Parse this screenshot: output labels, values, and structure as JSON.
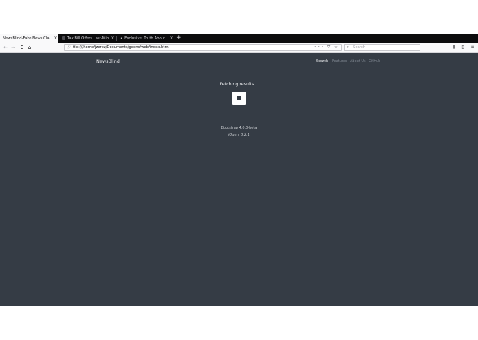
{
  "tabs": [
    {
      "title": "NewsBlind-Fake News Cla",
      "close": "×",
      "active": true
    },
    {
      "title": "Tax Bill Offers Last-Min",
      "close": "×",
      "active": false
    },
    {
      "title": "Exclusive: Truth About",
      "close": "×",
      "active": false
    }
  ],
  "new_tab_label": "+",
  "nav": {
    "back": "←",
    "forward": "→",
    "reload": "C",
    "home": "⌂",
    "info_icon": "ⓘ",
    "url": "file:///home/jzerez/Documents/goons/web/index.html",
    "page_actions": "••• ⛉ ☆",
    "search_icon": "⌕",
    "search_placeholder": "Search",
    "library": "⫼",
    "sidebar": "▯",
    "menu": "≡"
  },
  "site": {
    "brand": "NewsBlind",
    "menu": [
      "Search",
      "Features",
      "About Us",
      "GitHub"
    ],
    "status": "Fetching results...",
    "footer_line1": "Bootstrap 4.0.0-beta",
    "footer_line2": "jQuery 3.2.1"
  },
  "colors": {
    "page_background": "#353c45",
    "tab_strip": "#0c0c0d",
    "toolbar": "#f9f9fa"
  }
}
